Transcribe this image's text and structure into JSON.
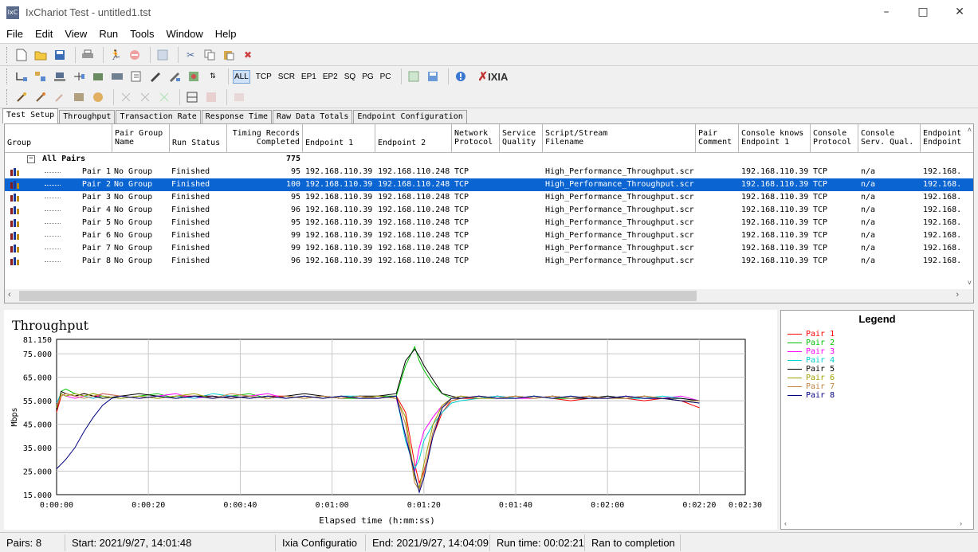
{
  "window": {
    "title": "IxChariot Test - untitled1.tst",
    "icon": "IxC"
  },
  "menu": [
    "File",
    "Edit",
    "View",
    "Run",
    "Tools",
    "Window",
    "Help"
  ],
  "toolbar": {
    "filters": [
      "ALL",
      "TCP",
      "SCR",
      "EP1",
      "EP2",
      "SQ",
      "PG",
      "PC"
    ],
    "brand": "IXIA"
  },
  "tabs": [
    "Test Setup",
    "Throughput",
    "Transaction Rate",
    "Response Time",
    "Raw Data Totals",
    "Endpoint Configuration"
  ],
  "grid": {
    "headers": {
      "group": "Group",
      "pair_group_name": "Pair Group\nName",
      "run_status": "Run Status",
      "timing_records": "Timing Records\nCompleted",
      "endpoint1": "Endpoint 1",
      "endpoint2": "Endpoint 2",
      "network_protocol": "Network\nProtocol",
      "service_quality": "Service\nQuality",
      "script": "Script/Stream\nFilename",
      "pair_comment": "Pair\nComment",
      "console_knows": "Console knows\nEndpoint 1",
      "console_protocol": "Console\nProtocol",
      "console_qual": "Console\nServ. Qual.",
      "endpoint_ep": "Endpoint\nEndpoint"
    },
    "all_pairs": {
      "toggle": "−",
      "label": "All Pairs",
      "total": "775"
    },
    "rows": [
      {
        "pair": "Pair 1",
        "group": "No Group",
        "status": "Finished",
        "records": "95",
        "ep1": "192.168.110.39",
        "ep2": "192.168.110.248",
        "proto": "TCP",
        "script": "High_Performance_Throughput.scr",
        "console": "192.168.110.39",
        "cproto": "TCP",
        "cqual": "n/a",
        "ep": "192.168."
      },
      {
        "pair": "Pair 2",
        "group": "No Group",
        "status": "Finished",
        "records": "100",
        "ep1": "192.168.110.39",
        "ep2": "192.168.110.248",
        "proto": "TCP",
        "script": "High_Performance_Throughput.scr",
        "console": "192.168.110.39",
        "cproto": "TCP",
        "cqual": "n/a",
        "ep": "192.168."
      },
      {
        "pair": "Pair 3",
        "group": "No Group",
        "status": "Finished",
        "records": "95",
        "ep1": "192.168.110.39",
        "ep2": "192.168.110.248",
        "proto": "TCP",
        "script": "High_Performance_Throughput.scr",
        "console": "192.168.110.39",
        "cproto": "TCP",
        "cqual": "n/a",
        "ep": "192.168."
      },
      {
        "pair": "Pair 4",
        "group": "No Group",
        "status": "Finished",
        "records": "96",
        "ep1": "192.168.110.39",
        "ep2": "192.168.110.248",
        "proto": "TCP",
        "script": "High_Performance_Throughput.scr",
        "console": "192.168.110.39",
        "cproto": "TCP",
        "cqual": "n/a",
        "ep": "192.168."
      },
      {
        "pair": "Pair 5",
        "group": "No Group",
        "status": "Finished",
        "records": "95",
        "ep1": "192.168.110.39",
        "ep2": "192.168.110.248",
        "proto": "TCP",
        "script": "High_Performance_Throughput.scr",
        "console": "192.168.110.39",
        "cproto": "TCP",
        "cqual": "n/a",
        "ep": "192.168."
      },
      {
        "pair": "Pair 6",
        "group": "No Group",
        "status": "Finished",
        "records": "99",
        "ep1": "192.168.110.39",
        "ep2": "192.168.110.248",
        "proto": "TCP",
        "script": "High_Performance_Throughput.scr",
        "console": "192.168.110.39",
        "cproto": "TCP",
        "cqual": "n/a",
        "ep": "192.168."
      },
      {
        "pair": "Pair 7",
        "group": "No Group",
        "status": "Finished",
        "records": "99",
        "ep1": "192.168.110.39",
        "ep2": "192.168.110.248",
        "proto": "TCP",
        "script": "High_Performance_Throughput.scr",
        "console": "192.168.110.39",
        "cproto": "TCP",
        "cqual": "n/a",
        "ep": "192.168."
      },
      {
        "pair": "Pair 8",
        "group": "No Group",
        "status": "Finished",
        "records": "96",
        "ep1": "192.168.110.39",
        "ep2": "192.168.110.248",
        "proto": "TCP",
        "script": "High_Performance_Throughput.scr",
        "console": "192.168.110.39",
        "cproto": "TCP",
        "cqual": "n/a",
        "ep": "192.168."
      }
    ],
    "selected_row": 1
  },
  "legend": {
    "title": "Legend",
    "items": [
      {
        "label": "Pair 1",
        "color": "#ff0000"
      },
      {
        "label": "Pair 2",
        "color": "#00c000"
      },
      {
        "label": "Pair 3",
        "color": "#ff00ff"
      },
      {
        "label": "Pair 4",
        "color": "#00d0d0"
      },
      {
        "label": "Pair 5",
        "color": "#000000"
      },
      {
        "label": "Pair 6",
        "color": "#a0a000"
      },
      {
        "label": "Pair 7",
        "color": "#c08040"
      },
      {
        "label": "Pair 8",
        "color": "#000080"
      }
    ]
  },
  "chart_data": {
    "type": "line",
    "title": "Throughput",
    "xlabel": "Elapsed time (h:mm:ss)",
    "ylabel": "Mbps",
    "ylim": [
      15.0,
      81.15
    ],
    "xlim": [
      0,
      150
    ],
    "yticks": [
      "81.150",
      "75.000",
      "65.000",
      "55.000",
      "45.000",
      "35.000",
      "25.000",
      "15.000"
    ],
    "ytick_values": [
      81.15,
      75,
      65,
      55,
      45,
      35,
      25,
      15
    ],
    "xticks": [
      "0:00:00",
      "0:00:20",
      "0:00:40",
      "0:01:00",
      "0:01:20",
      "0:01:40",
      "0:02:00",
      "0:02:20",
      "0:02:30"
    ],
    "xtick_values": [
      0,
      20,
      40,
      60,
      80,
      100,
      120,
      140,
      150
    ],
    "grid": true,
    "series": [
      {
        "name": "Pair 1",
        "x": [
          0,
          1,
          2,
          4,
          6,
          8,
          10,
          14,
          18,
          22,
          26,
          30,
          34,
          38,
          42,
          46,
          50,
          54,
          58,
          62,
          66,
          70,
          74,
          76,
          78,
          79,
          80,
          82,
          84,
          86,
          88,
          92,
          96,
          100,
          104,
          108,
          112,
          116,
          120,
          124,
          128,
          132,
          136,
          140
        ],
        "y": [
          50,
          57,
          58,
          57,
          58,
          57,
          57,
          56,
          57,
          56,
          57,
          57,
          56,
          57,
          56,
          57,
          57,
          56,
          57,
          56,
          57,
          56,
          57,
          50,
          28,
          20,
          25,
          40,
          50,
          55,
          56,
          56,
          57,
          56,
          57,
          56,
          55,
          56,
          57,
          56,
          55,
          56,
          55,
          52
        ]
      },
      {
        "name": "Pair 2",
        "x": [
          0,
          1,
          2,
          4,
          6,
          8,
          10,
          14,
          18,
          22,
          26,
          30,
          34,
          38,
          42,
          46,
          50,
          54,
          58,
          62,
          66,
          70,
          74,
          76,
          78,
          79,
          80,
          82,
          84,
          86,
          88,
          92,
          96,
          100,
          104,
          108,
          112,
          116,
          120,
          124,
          128,
          132,
          136,
          140
        ],
        "y": [
          52,
          59,
          60,
          58,
          57,
          58,
          57,
          56,
          57,
          58,
          56,
          57,
          56,
          57,
          58,
          56,
          57,
          56,
          57,
          56,
          56,
          57,
          57,
          70,
          78,
          72,
          68,
          62,
          58,
          56,
          57,
          56,
          57,
          56,
          57,
          56,
          56,
          57,
          56,
          57,
          56,
          56,
          55,
          55
        ]
      },
      {
        "name": "Pair 3",
        "x": [
          0,
          1,
          2,
          4,
          6,
          8,
          10,
          14,
          18,
          22,
          26,
          30,
          34,
          38,
          42,
          46,
          50,
          54,
          58,
          62,
          66,
          70,
          74,
          76,
          78,
          79,
          80,
          82,
          84,
          86,
          88,
          92,
          96,
          100,
          104,
          108,
          112,
          116,
          120,
          124,
          128,
          132,
          136,
          140
        ],
        "y": [
          53,
          58,
          57,
          56,
          57,
          56,
          58,
          57,
          56,
          57,
          58,
          56,
          57,
          56,
          57,
          58,
          56,
          57,
          56,
          57,
          56,
          57,
          56,
          40,
          25,
          35,
          42,
          48,
          53,
          56,
          57,
          56,
          57,
          56,
          56,
          57,
          56,
          57,
          56,
          57,
          56,
          56,
          57,
          55
        ]
      },
      {
        "name": "Pair 4",
        "x": [
          0,
          1,
          2,
          4,
          6,
          8,
          10,
          14,
          18,
          22,
          26,
          30,
          34,
          38,
          42,
          46,
          50,
          54,
          58,
          62,
          66,
          70,
          74,
          76,
          78,
          79,
          80,
          82,
          84,
          86,
          88,
          92,
          96,
          100,
          104,
          108,
          112,
          116,
          120,
          124,
          128,
          132,
          136,
          140
        ],
        "y": [
          54,
          58,
          57,
          58,
          57,
          56,
          57,
          56,
          57,
          56,
          57,
          56,
          58,
          57,
          56,
          57,
          56,
          57,
          56,
          57,
          57,
          56,
          57,
          38,
          26,
          30,
          38,
          45,
          50,
          54,
          55,
          56,
          57,
          56,
          57,
          56,
          57,
          56,
          57,
          56,
          56,
          57,
          56,
          55
        ]
      },
      {
        "name": "Pair 5",
        "x": [
          0,
          1,
          2,
          4,
          6,
          8,
          10,
          14,
          18,
          22,
          26,
          30,
          34,
          38,
          42,
          46,
          50,
          54,
          58,
          62,
          66,
          70,
          74,
          76,
          78,
          79,
          80,
          82,
          84,
          86,
          88,
          92,
          96,
          100,
          104,
          108,
          112,
          116,
          120,
          124,
          128,
          132,
          136,
          140
        ],
        "y": [
          51,
          59,
          58,
          57,
          58,
          57,
          56,
          57,
          58,
          57,
          56,
          57,
          57,
          56,
          57,
          56,
          57,
          58,
          57,
          56,
          57,
          57,
          58,
          72,
          77,
          74,
          70,
          64,
          58,
          57,
          56,
          57,
          56,
          57,
          56,
          57,
          56,
          56,
          57,
          56,
          57,
          56,
          56,
          55
        ]
      },
      {
        "name": "Pair 6",
        "x": [
          0,
          1,
          2,
          4,
          6,
          8,
          10,
          14,
          18,
          22,
          26,
          30,
          34,
          38,
          42,
          46,
          50,
          54,
          58,
          62,
          66,
          70,
          74,
          76,
          78,
          79,
          80,
          82,
          84,
          86,
          88,
          92,
          96,
          100,
          104,
          108,
          112,
          116,
          120,
          124,
          128,
          132,
          136,
          140
        ],
        "y": [
          52,
          58,
          57,
          58,
          57,
          58,
          57,
          56,
          57,
          56,
          57,
          58,
          56,
          57,
          56,
          57,
          56,
          57,
          56,
          57,
          56,
          57,
          56,
          48,
          22,
          18,
          28,
          45,
          53,
          56,
          57,
          56,
          56,
          57,
          56,
          57,
          56,
          57,
          56,
          56,
          57,
          56,
          55,
          54
        ]
      },
      {
        "name": "Pair 7",
        "x": [
          0,
          1,
          2,
          4,
          6,
          8,
          10,
          14,
          18,
          22,
          26,
          30,
          34,
          38,
          42,
          46,
          50,
          54,
          58,
          62,
          66,
          70,
          74,
          76,
          78,
          79,
          80,
          82,
          84,
          86,
          88,
          92,
          96,
          100,
          104,
          108,
          112,
          116,
          120,
          124,
          128,
          132,
          136,
          140
        ],
        "y": [
          53,
          57,
          58,
          57,
          56,
          57,
          58,
          57,
          56,
          57,
          56,
          57,
          56,
          58,
          57,
          56,
          57,
          56,
          57,
          56,
          57,
          56,
          57,
          45,
          20,
          17,
          24,
          42,
          52,
          55,
          56,
          57,
          56,
          57,
          56,
          57,
          56,
          57,
          56,
          56,
          57,
          56,
          55,
          55
        ]
      },
      {
        "name": "Pair 8",
        "x": [
          0,
          2,
          4,
          6,
          8,
          10,
          12,
          14,
          18,
          22,
          26,
          30,
          34,
          38,
          42,
          46,
          50,
          54,
          58,
          62,
          66,
          70,
          74,
          76,
          78,
          79,
          80,
          82,
          84,
          86,
          88,
          92,
          96,
          100,
          104,
          108,
          112,
          116,
          120,
          124,
          128,
          132,
          136,
          140
        ],
        "y": [
          26,
          30,
          35,
          42,
          48,
          53,
          56,
          57,
          56,
          57,
          56,
          57,
          56,
          57,
          56,
          57,
          56,
          57,
          56,
          57,
          56,
          56,
          57,
          40,
          24,
          16,
          22,
          40,
          52,
          56,
          56,
          57,
          56,
          56,
          57,
          56,
          57,
          56,
          56,
          57,
          56,
          56,
          55,
          54
        ]
      }
    ]
  },
  "status": {
    "pairs": "Pairs: 8",
    "start": "Start: 2021/9/27, 14:01:48",
    "config": "Ixia Configuratio",
    "end": "End: 2021/9/27, 14:04:09",
    "runtime": "Run time: 00:02:21",
    "result": "Ran to completion"
  }
}
